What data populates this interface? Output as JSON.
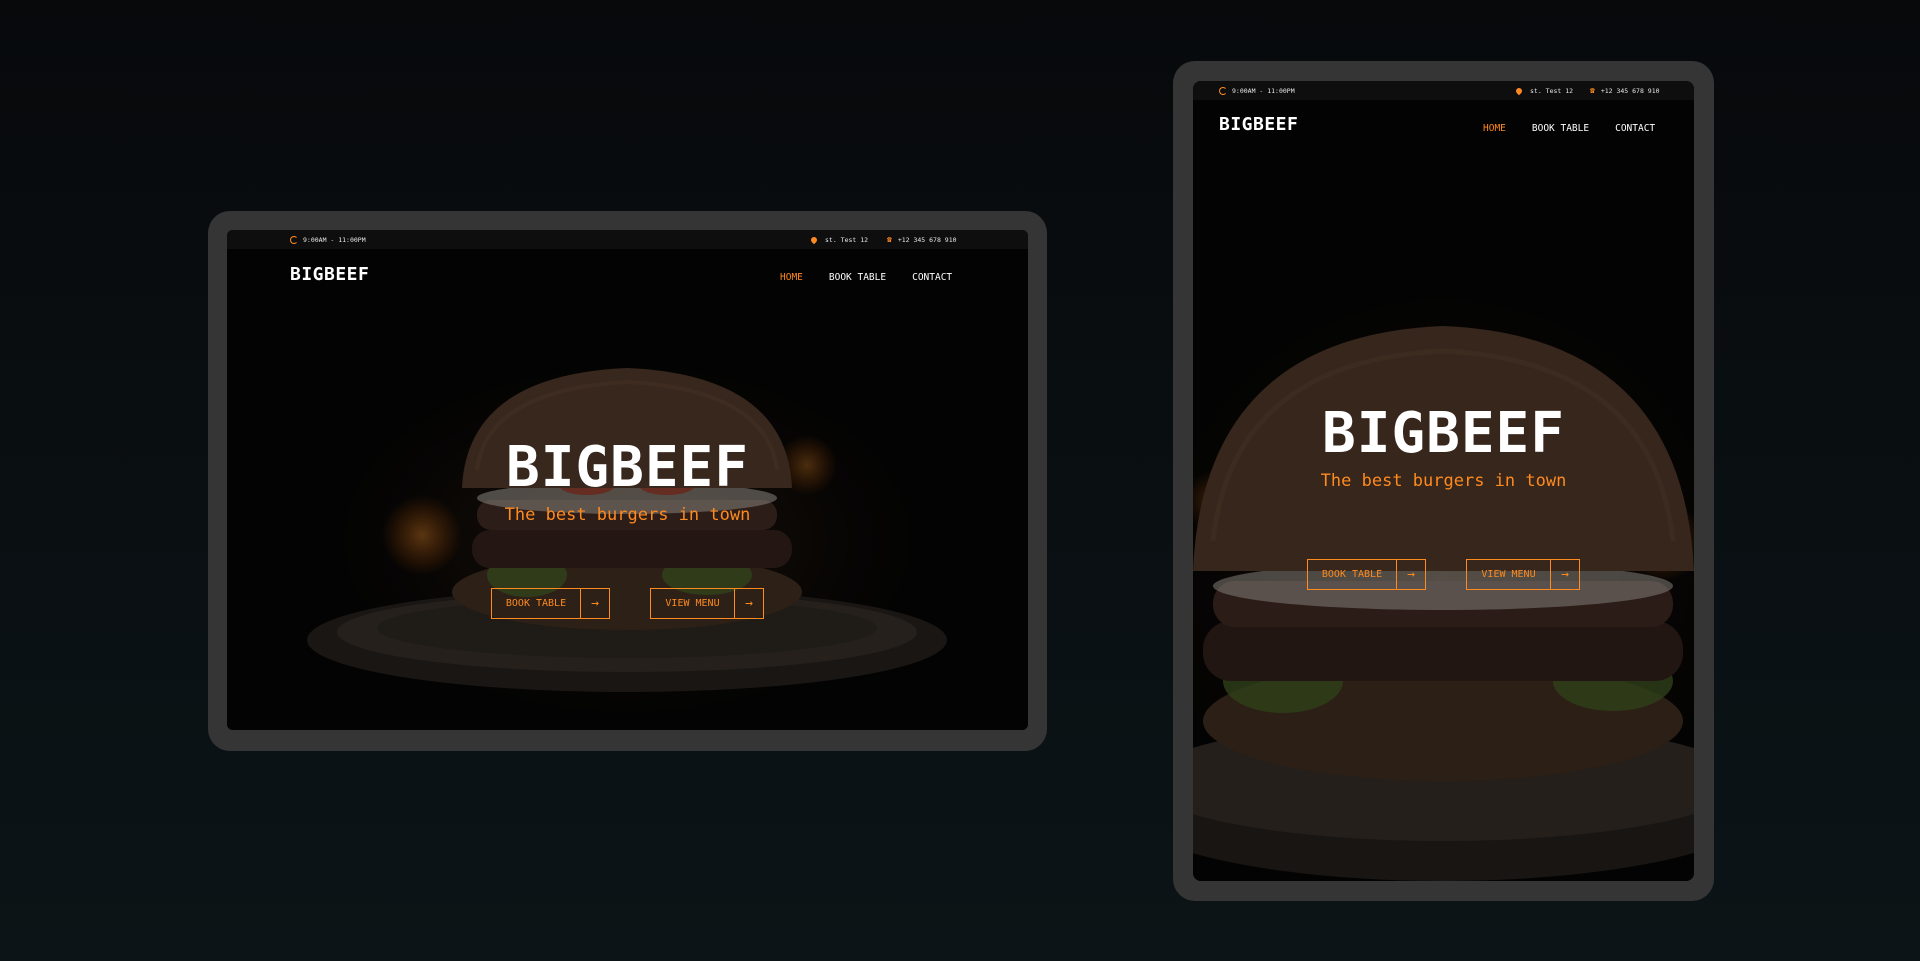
{
  "site": {
    "hours": "9:00AM - 11:00PM",
    "address": "st. Test 12",
    "phone": "+12 345 678 910",
    "logo": "BIGBEEF",
    "nav": [
      {
        "label": "HOME",
        "active": true
      },
      {
        "label": "BOOK TABLE",
        "active": false
      },
      {
        "label": "CONTACT",
        "active": false
      }
    ],
    "hero_title": "BIGBEEF",
    "hero_subtitle": "The best burgers in town",
    "book_button": "BOOK TABLE",
    "menu_button": "VIEW MENU",
    "arrow_icon": "→"
  },
  "colors": {
    "accent": "#ff8a1f",
    "device_frame": "#353535",
    "page_background": "#0a1013"
  },
  "icons": [
    "clock-icon",
    "location-pin-icon",
    "phone-icon",
    "arrow-right-icon"
  ]
}
